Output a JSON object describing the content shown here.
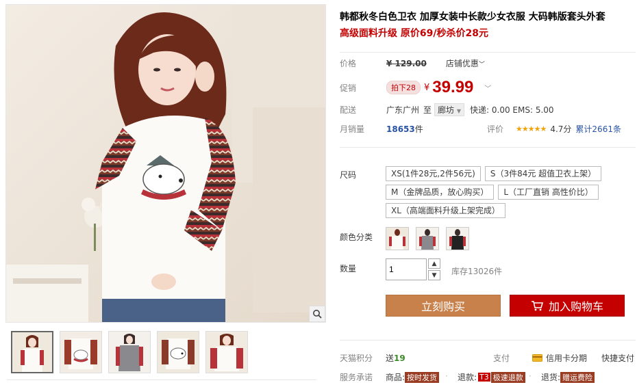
{
  "product": {
    "title": "韩都秋冬白色卫衣 加厚女装中长款少女衣服 大码韩版套头外套",
    "subtitle": "高级面料升级 原价69/秒杀价28元"
  },
  "price": {
    "label": "价格",
    "original": "¥ 129.00",
    "shop_discount": "店铺优惠"
  },
  "promo": {
    "label": "促销",
    "tag": "拍下28",
    "currency": "¥",
    "value": "39.99"
  },
  "shipping": {
    "label": "配送",
    "from": "广东广州",
    "to_label": "至",
    "destination": "廊坊",
    "fees": "快递: 0.00 EMS: 5.00"
  },
  "sales": {
    "label": "月销量",
    "count": "18653",
    "unit": "件",
    "review_label": "评价",
    "stars": "★★★★★",
    "rating": "4.7分",
    "total_reviews": "累计2661条"
  },
  "size": {
    "label": "尺码",
    "options": [
      "XS(1件28元,2件56元)",
      "S（3件84元 超值卫衣上架）",
      "M（金牌品质，放心购买）",
      "L（工厂直销 高性价比）",
      "XL（高端面料升级上架完成）"
    ]
  },
  "color": {
    "label": "颜色分类"
  },
  "quantity": {
    "label": "数量",
    "value": "1",
    "stock": "库存13026件"
  },
  "buttons": {
    "buy_now": "立刻购买",
    "add_cart": "加入购物车"
  },
  "footer": {
    "points_label": "天猫积分",
    "points_prefix": "送",
    "points_value": "19",
    "pay_label": "支付",
    "credit": "信用卡分期",
    "quick_pay": "快捷支付",
    "service_label": "服务承诺",
    "goods_label": "商品:",
    "goods_badge": "按时发货",
    "refund_label": "退款:",
    "refund_t3": "T3",
    "refund_badge": "极速退款",
    "return_label": "退货:",
    "return_badge": "赠运费险"
  },
  "colors": {
    "accent_red": "#c40000",
    "buy_orange": "#c8814b",
    "link_blue": "#2953a6"
  }
}
